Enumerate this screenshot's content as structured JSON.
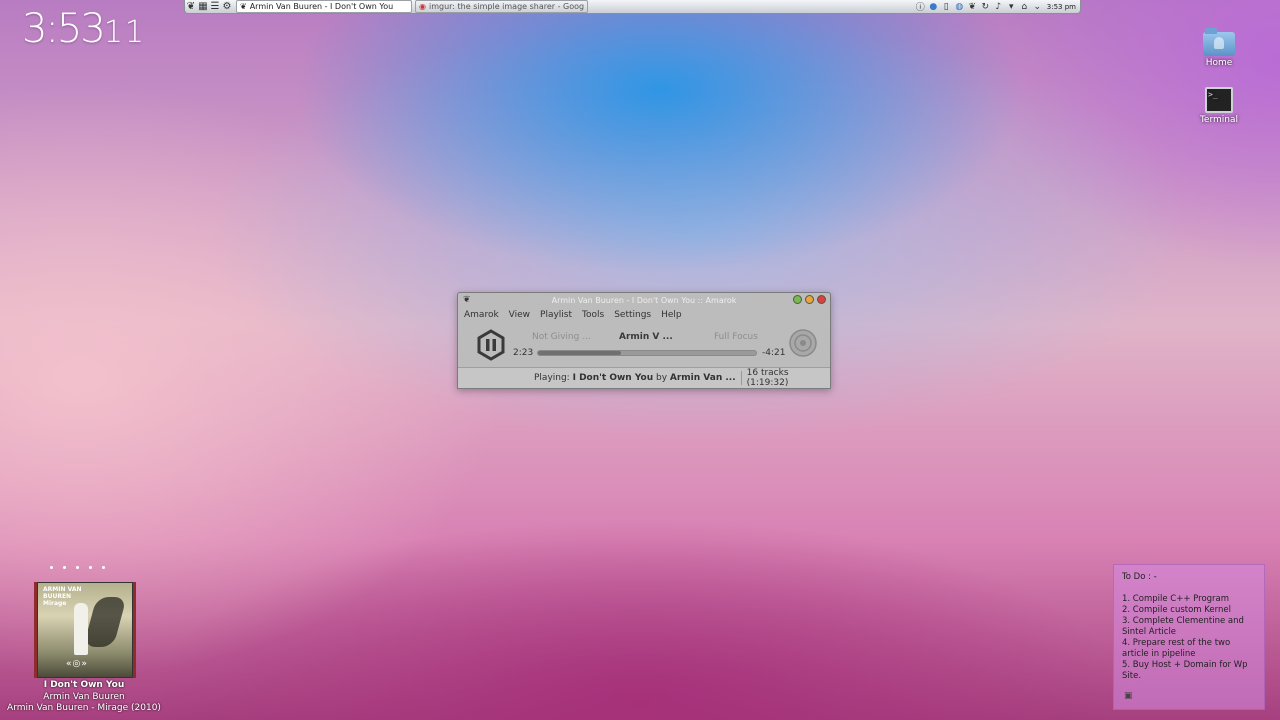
{
  "panel": {
    "tasks": [
      {
        "label": "Armin Van Buuren - I Don't Own You",
        "active": true
      },
      {
        "label": "imgur: the simple image sharer - Goog",
        "active": false
      }
    ],
    "clock": "3:53 pm"
  },
  "clock_widget": {
    "hours": "3:53",
    "minutes": "11"
  },
  "desktop": {
    "icons": [
      {
        "label": "Home",
        "icon": "folder-icon"
      },
      {
        "label": "Terminal",
        "icon": "terminal-icon"
      }
    ]
  },
  "amarok": {
    "title": "Armin Van Buuren - I Don't Own You  ::  Amarok",
    "menu": [
      "Amarok",
      "View",
      "Playlist",
      "Tools",
      "Settings",
      "Help"
    ],
    "prev_track": "Not Giving ...",
    "current_track": "Armin V ...",
    "next_track": "Full Focus",
    "elapsed": "2:23",
    "remaining": "-4:21",
    "progress": 0.38,
    "status_prefix": "Playing: ",
    "status_song": "I Don't Own You",
    "status_by": " by ",
    "status_artist": "Armin Van ...",
    "tracks": "16 tracks (1:19:32)"
  },
  "now_playing": {
    "song": "I Don't Own You",
    "artist": "Armin Van Buuren",
    "album": "Armin Van Buuren - Mirage (2010)",
    "cover_text": "ARMIN VAN BUUREN Mirage",
    "controls": "«◎»"
  },
  "note": {
    "heading": "To Do : -",
    "items": [
      "1. Compile C++ Program",
      "2. Compile custom Kernel",
      "3. Complete Clementine and Sintel Article",
      "4. Prepare rest of the two article in pipeline",
      "5. Buy Host + Domain for Wp Site."
    ]
  },
  "colors": {
    "accent": "#2b95e0",
    "window": "#bcbcbc",
    "note": "#d68ce0"
  }
}
